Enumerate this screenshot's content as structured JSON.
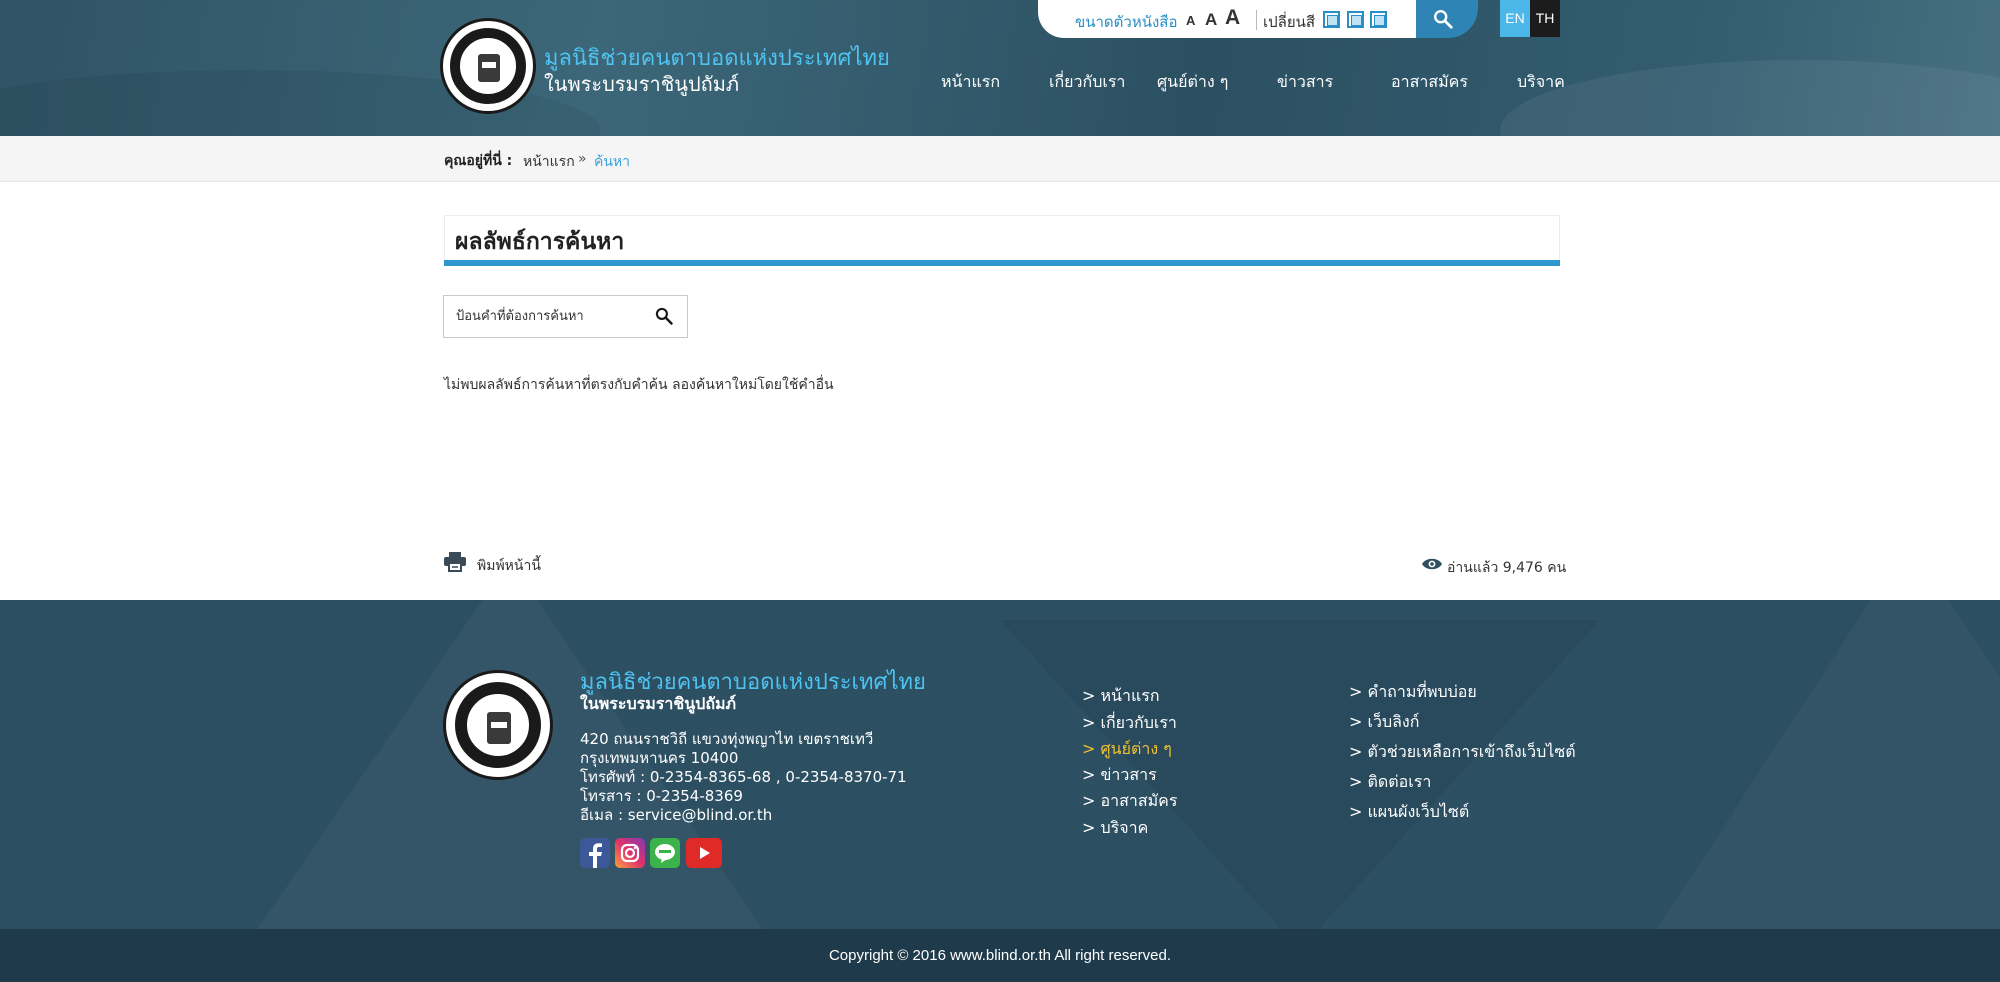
{
  "header": {
    "org_name": "มูลนิธิช่วยคนตาบอดแห่งประเทศไทย",
    "org_sub": "ในพระบรมราชินูปถัมภ์",
    "font_size_label": "ขนาดตัวหนังสือ",
    "font_sizes": [
      "A",
      "A",
      "A"
    ],
    "change_color_label": "เปลี่ยนสี",
    "lang_en": "EN",
    "lang_th": "TH",
    "nav": [
      "หน้าแรก",
      "เกี่ยวกับเรา",
      "ศูนย์ต่าง ๆ",
      "ข่าวสาร",
      "อาสาสมัคร",
      "บริจาค"
    ]
  },
  "breadcrumb": {
    "label": "คุณอยู่ที่นี่ :",
    "home": "หน้าแรก",
    "separator": "»",
    "current": "ค้นหา"
  },
  "main": {
    "title": "ผลลัพธ์การค้นหา",
    "search_placeholder": "ป้อนคำที่ต้องการค้นหา",
    "no_result": "ไม่พบผลลัพธ์การค้นหาที่ตรงกับคำค้น ลองค้นหาใหม่โดยใช้คำอื่น",
    "print_label": "พิมพ์หน้านี้",
    "views_label": "อ่านแล้ว 9,476 คน"
  },
  "footer": {
    "org_name": "มูลนิธิช่วยคนตาบอดแห่งประเทศไทย",
    "org_sub": "ในพระบรมราชินูปถัมภ์",
    "address": [
      "420 ถนนราชวิถี แขวงทุ่งพญาไท เขตราชเทวี",
      "กรุงเทพมหานคร 10400",
      "โทรศัพท์ : 0-2354-8365-68 , 0-2354-8370-71",
      "โทรสาร : 0-2354-8369",
      "อีเมล : service@blind.or.th"
    ],
    "links_col1": [
      "> หน้าแรก",
      "> เกี่ยวกับเรา",
      "> ศูนย์ต่าง ๆ",
      "> ข่าวสาร",
      "> อาสาสมัคร",
      "> บริจาค"
    ],
    "links_col2": [
      "> คำถามที่พบบ่อย",
      "> เว็บลิงก์",
      "> ตัวช่วยเหลือการเข้าถึงเว็บไซต์",
      "> ติดต่อเรา",
      "> แผนผังเว็บไซต์"
    ],
    "copyright": "Copyright © 2016 www.blind.or.th All right reserved."
  },
  "colors": {
    "accent_blue": "#2f96cf",
    "light_blue": "#4fc3f0",
    "active_yellow": "#f2c12e",
    "footer_bg": "#2c4f62"
  }
}
